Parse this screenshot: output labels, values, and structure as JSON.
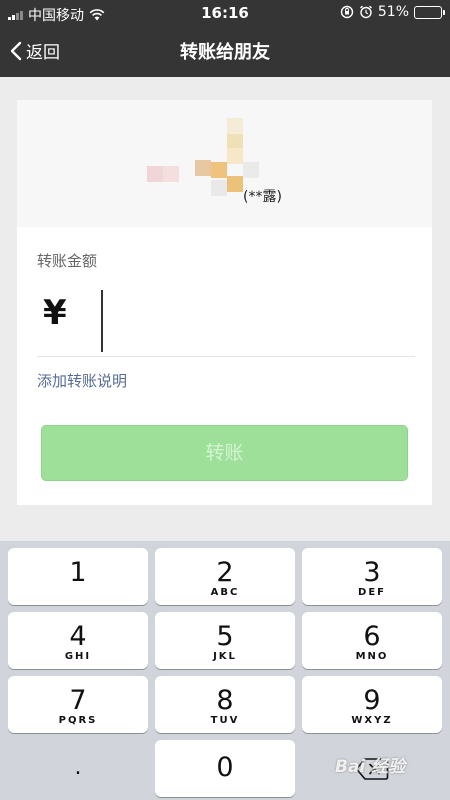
{
  "status_bar": {
    "carrier": "中国移动",
    "time": "16:16",
    "battery": "51%",
    "battery_level": 0.51,
    "icons": [
      "signal-icon",
      "wifi-icon",
      "rotation-lock-icon",
      "alarm-icon",
      "battery-icon"
    ]
  },
  "nav": {
    "back_label": "返回",
    "title": "转账给朋友"
  },
  "recipient": {
    "name": "(**露)",
    "avatar_colors": [
      "#f1d6d8",
      "#f4dede",
      "#e8c8a0",
      "#efc37e",
      "#f6e7c8",
      "#eaeaea",
      "#f0e0b8",
      "#ecc27a",
      "#f5ecd8",
      "#e9e9e9"
    ]
  },
  "transfer": {
    "amount_label": "转账金额",
    "currency_symbol": "¥",
    "amount_value": "",
    "add_note_label": "添加转账说明",
    "button_label": "转账"
  },
  "keypad": {
    "keys": [
      {
        "num": "1",
        "letters": ""
      },
      {
        "num": "2",
        "letters": "ABC"
      },
      {
        "num": "3",
        "letters": "DEF"
      },
      {
        "num": "4",
        "letters": "GHI"
      },
      {
        "num": "5",
        "letters": "JKL"
      },
      {
        "num": "6",
        "letters": "MNO"
      },
      {
        "num": "7",
        "letters": "PQRS"
      },
      {
        "num": "8",
        "letters": "TUV"
      },
      {
        "num": "9",
        "letters": "WXYZ"
      },
      {
        "num": ".",
        "letters": ""
      },
      {
        "num": "0",
        "letters": ""
      }
    ],
    "delete_icon": "backspace-icon"
  },
  "watermark": "Bai 经验",
  "colors": {
    "nav_bg": "#353535",
    "button_disabled": "#9ee09a",
    "link": "#576b95",
    "keypad_bg": "#d1d4da"
  }
}
